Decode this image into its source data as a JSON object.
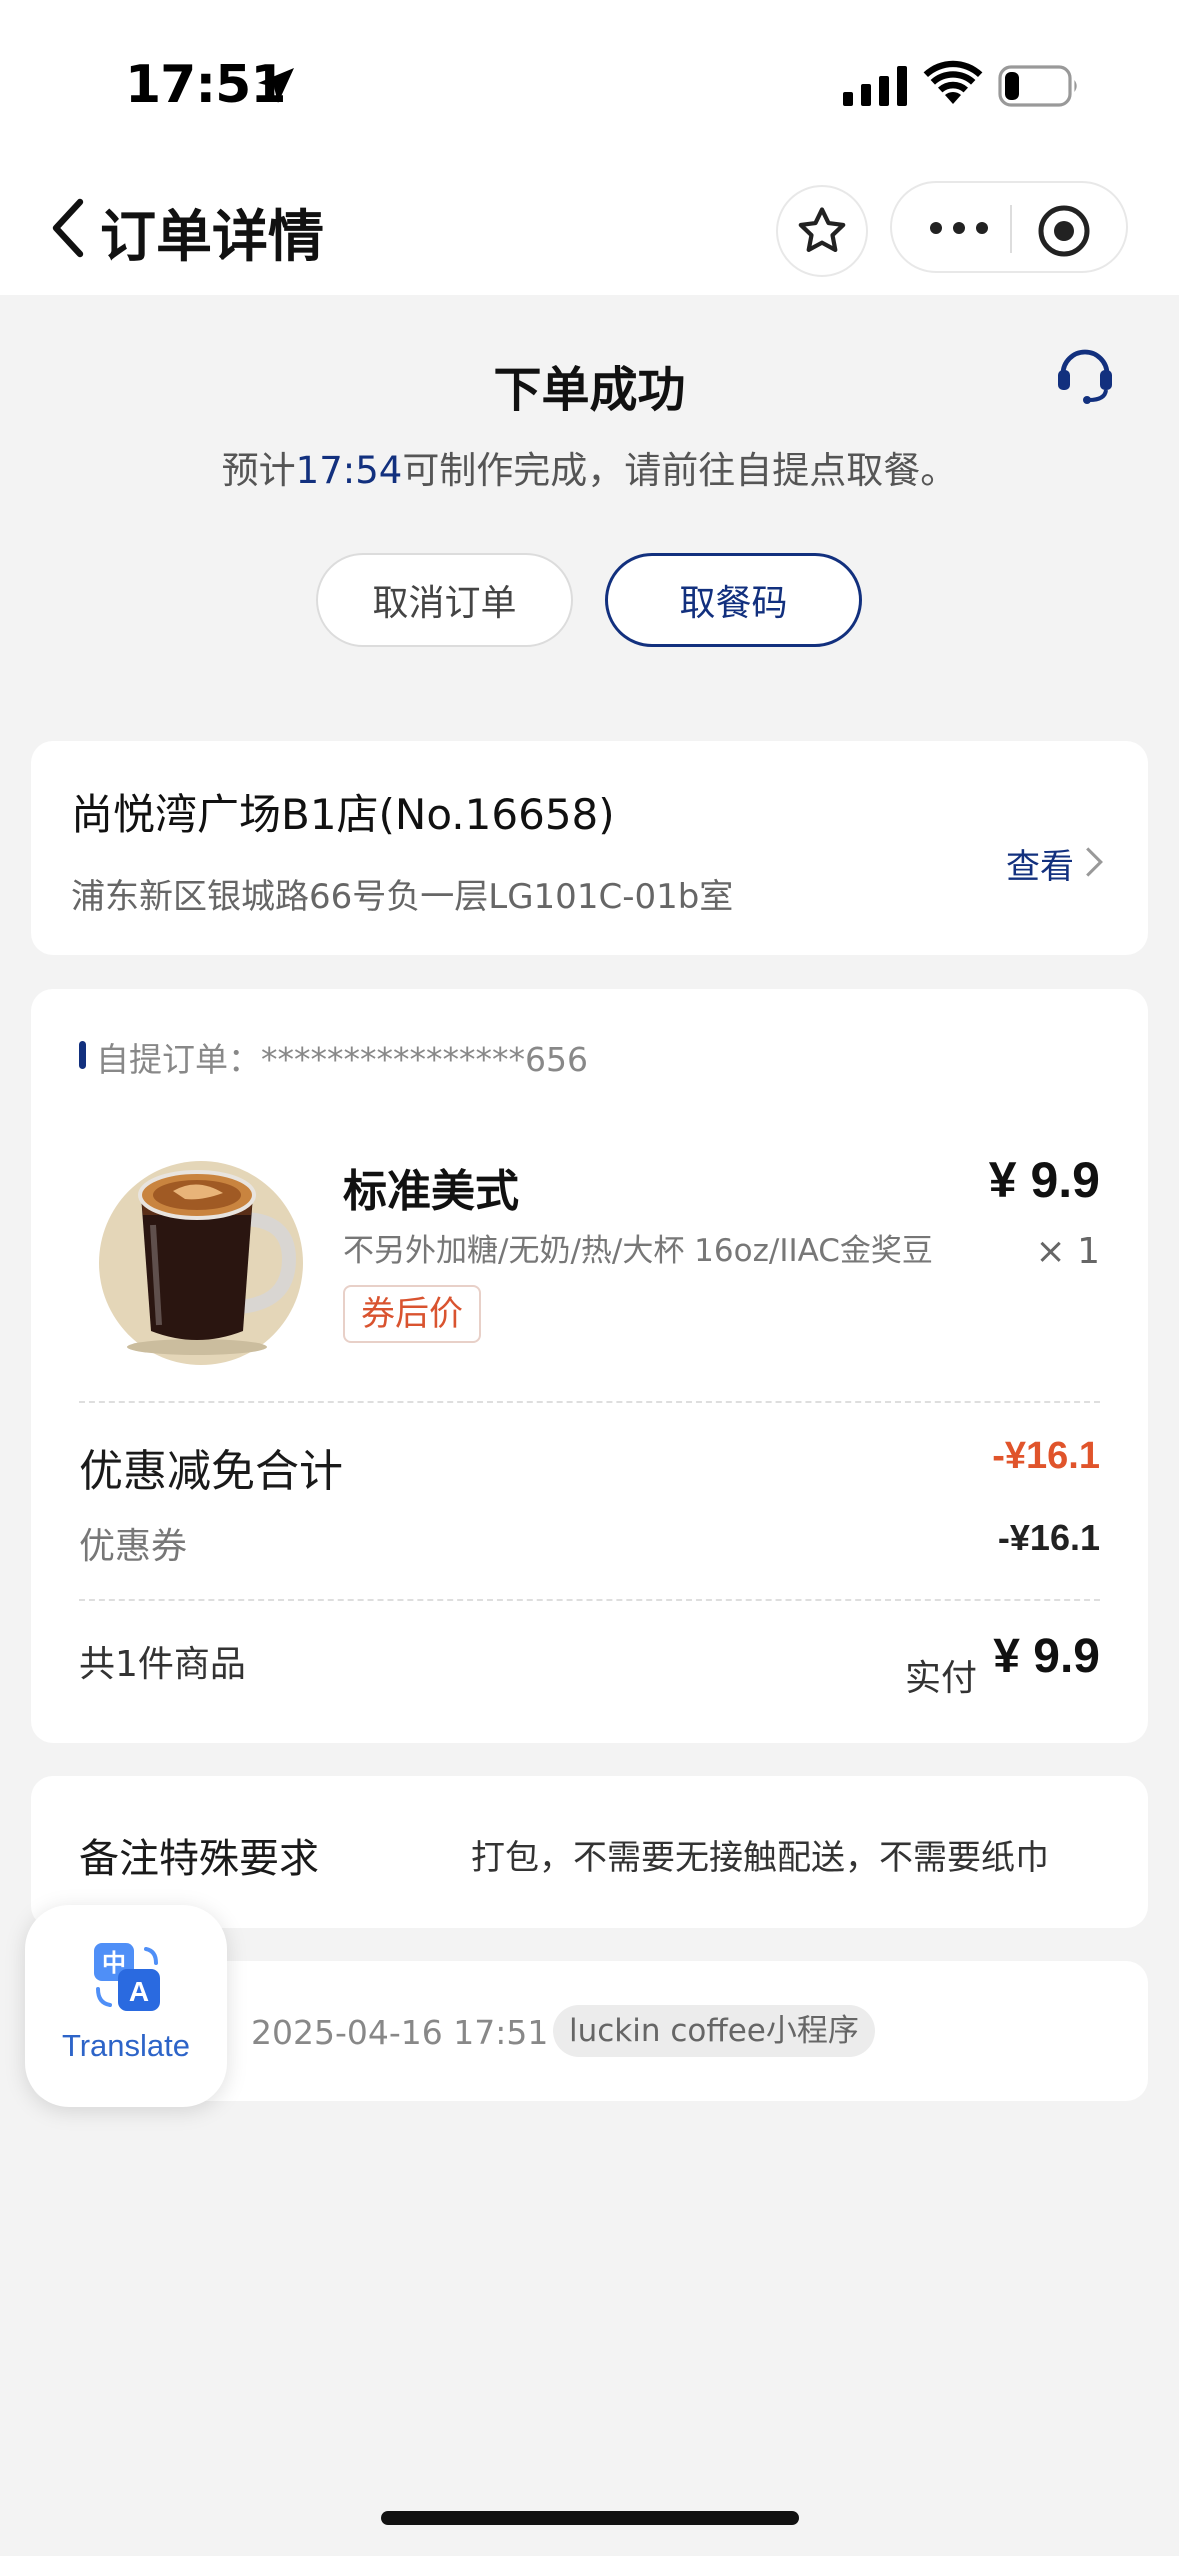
{
  "status_bar": {
    "time": "17:51"
  },
  "nav": {
    "title": "订单详情"
  },
  "order_status": {
    "title": "下单成功",
    "desc_prefix": "预计",
    "desc_time": "17:54",
    "desc_suffix": "可制作完成，请前往自提点取餐。",
    "cancel_label": "取消订单",
    "pickup_code_label": "取餐码"
  },
  "store": {
    "name": "尚悦湾广场B1店(No.16658)",
    "address": "浦东新区银城路66号负一层LG101C-01b室",
    "view_label": "查看"
  },
  "order": {
    "pickup_label": "自提订单：",
    "order_no": "****************656",
    "item": {
      "name": "标准美式",
      "spec": "不另外加糖/无奶/热/大杯 16oz/IIAC金奖豆",
      "tag": "券后价",
      "price": "¥ 9.9",
      "qty": "× 1"
    },
    "discount_total_label": "优惠减免合计",
    "discount_total_value": "-¥16.1",
    "coupon_label": "优惠券",
    "coupon_value": "-¥16.1",
    "count_label": "共1件商品",
    "paid_label": "实付",
    "paid_value": "¥ 9.9"
  },
  "remark": {
    "label": "备注特殊要求",
    "value": "打包，不需要无接触配送，不需要纸巾"
  },
  "meta": {
    "time": "2025-04-16 17:51",
    "source": "luckin coffee小程序"
  },
  "translate": {
    "label": "Translate"
  },
  "colors": {
    "brand": "#12307e",
    "discount": "#e0542b",
    "background": "#f3f3f3"
  }
}
